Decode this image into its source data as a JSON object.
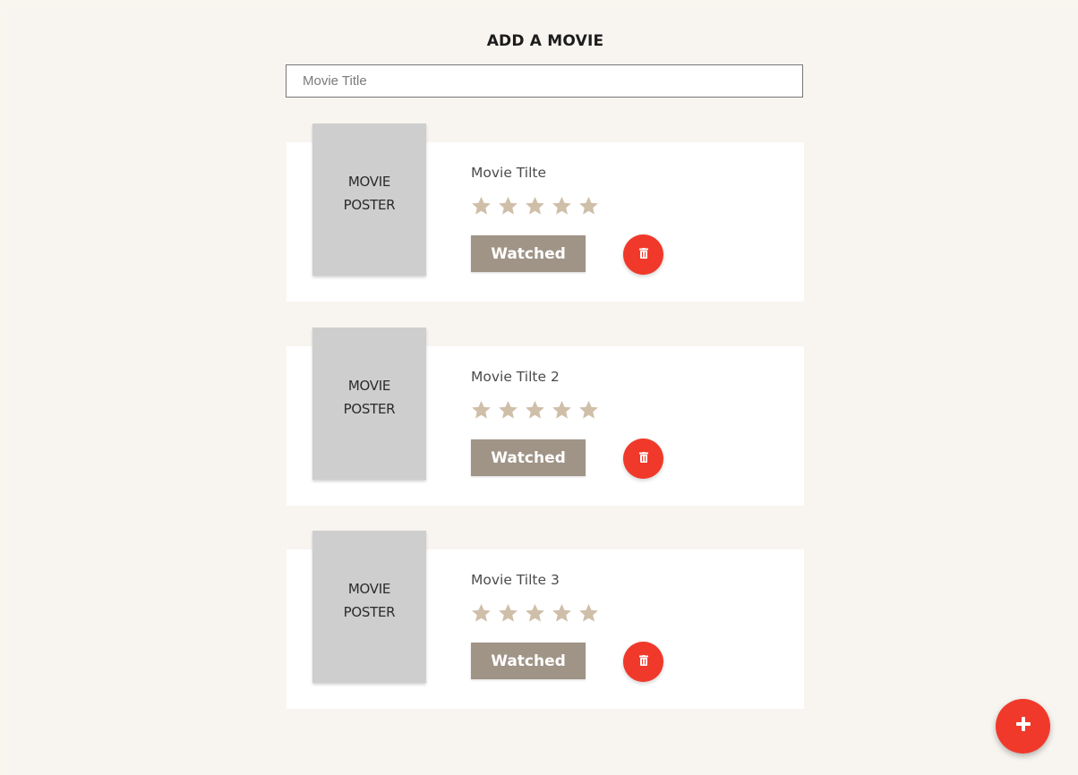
{
  "header": {
    "title": "ADD A MOVIE"
  },
  "search": {
    "placeholder": "Movie Title",
    "value": ""
  },
  "movies": [
    {
      "poster_label": "MOVIE\nPOSTER",
      "title": "Movie Tilte",
      "rating": 5,
      "watched_label": "Watched",
      "delete_icon": "trash-icon"
    },
    {
      "poster_label": "MOVIE\nPOSTER",
      "title": "Movie Tilte 2",
      "rating": 5,
      "watched_label": "Watched",
      "delete_icon": "trash-icon"
    },
    {
      "poster_label": "MOVIE\nPOSTER",
      "title": "Movie Tilte 3",
      "rating": 5,
      "watched_label": "Watched",
      "delete_icon": "trash-icon"
    }
  ],
  "fab": {
    "icon": "plus-icon"
  },
  "colors": {
    "background": "#f8f5f0",
    "card": "#ffffff",
    "poster": "#cecece",
    "star": "#cfbfa9",
    "watched_button": "#a09487",
    "accent_red": "#f0392a"
  }
}
